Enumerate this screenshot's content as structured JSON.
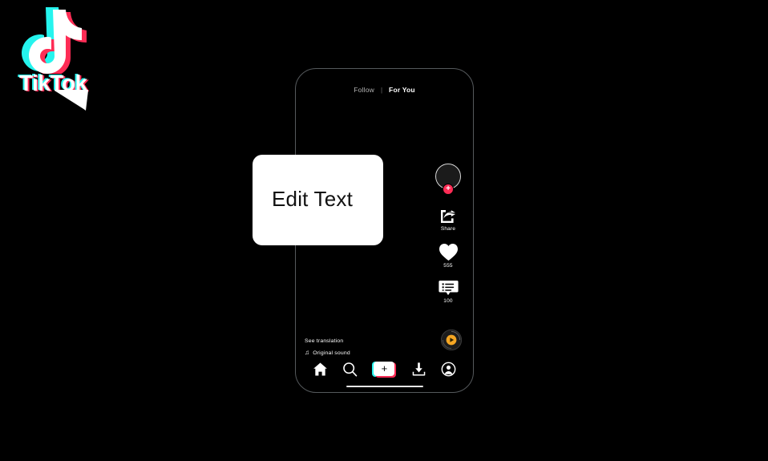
{
  "brand": {
    "name": "TikTok",
    "logo_icon": "tiktok-note-logo",
    "accent_cyan": "#25f4ee",
    "accent_pink": "#fe2c55"
  },
  "callout": {
    "text": "Edit Text",
    "shape": "speech-bubble",
    "background": "#ffffff",
    "text_color": "#111111"
  },
  "phone": {
    "frame_color": "#55595c",
    "screen_background": "#000000",
    "feed_tabs": {
      "follow_label": "Follow",
      "divider": "|",
      "for_you_label": "For You",
      "active": "For You"
    },
    "action_rail": [
      {
        "name": "profile-avatar",
        "icon": "avatar-circle",
        "badge_icon": "plus-badge",
        "badge_color": "#fe2c55",
        "label": ""
      },
      {
        "name": "share",
        "icon": "share-arrow-icon",
        "label": "Share"
      },
      {
        "name": "like",
        "icon": "heart-icon",
        "label": "555"
      },
      {
        "name": "comment",
        "icon": "comment-list-icon",
        "label": "100"
      }
    ],
    "music_disc": {
      "icon": "vinyl-record-icon",
      "center_color": "#f5a623"
    },
    "caption": {
      "translate_label": "See translation",
      "sound_icon": "music-note-icon",
      "sound_label": "Original sound"
    },
    "navbar": [
      {
        "name": "home",
        "icon": "home-icon",
        "label": ""
      },
      {
        "name": "discover",
        "icon": "search-icon",
        "label": ""
      },
      {
        "name": "create",
        "icon": "plus-icon",
        "label": ""
      },
      {
        "name": "inbox",
        "icon": "download-tray-icon",
        "label": ""
      },
      {
        "name": "profile",
        "icon": "person-circle-icon",
        "label": ""
      }
    ],
    "home_indicator": true
  }
}
